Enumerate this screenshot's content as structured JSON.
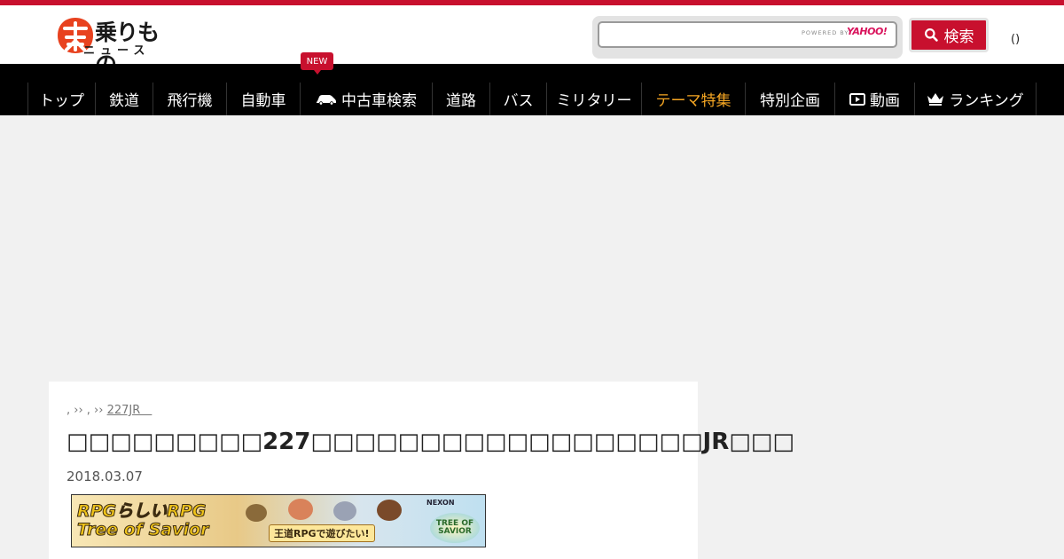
{
  "brand": {
    "logo_top": "乗りもの",
    "logo_bottom": "ニュース",
    "accent_color": "#c8102e"
  },
  "search": {
    "placeholder": "",
    "powered_by": "POWERED BY",
    "provider": "YAHOO!",
    "button_label": "検索"
  },
  "header": {
    "login_text": "()"
  },
  "nav": {
    "new_badge": "NEW",
    "items": [
      {
        "label": "トップ"
      },
      {
        "label": "鉄道"
      },
      {
        "label": "飛行機"
      },
      {
        "label": "自動車"
      },
      {
        "label": "中古車検索",
        "icon": "car-icon"
      },
      {
        "label": "道路"
      },
      {
        "label": "バス"
      },
      {
        "label": "ミリタリー"
      },
      {
        "label": "テーマ特集",
        "accent": "#f5a623"
      },
      {
        "label": "特別企画"
      },
      {
        "label": "動画",
        "icon": "video-icon"
      },
      {
        "label": "ランキング",
        "icon": "crown-icon"
      }
    ]
  },
  "article": {
    "breadcrumb_prefix": ",  ›› ,  ›› ",
    "breadcrumb_link": "227JR＿",
    "title": "□□□□□□□□□227□□□□□□□□□□□□□□□□□□JR□□□",
    "date": "2018.03.07"
  },
  "ad_banner": {
    "line1": "RPGらしいRPG",
    "line2": "Tree of Savior",
    "middle": "王道RPGで遊びたい!",
    "publisher": "NEXON",
    "game_logo": "TREE OF SAVIOR"
  }
}
